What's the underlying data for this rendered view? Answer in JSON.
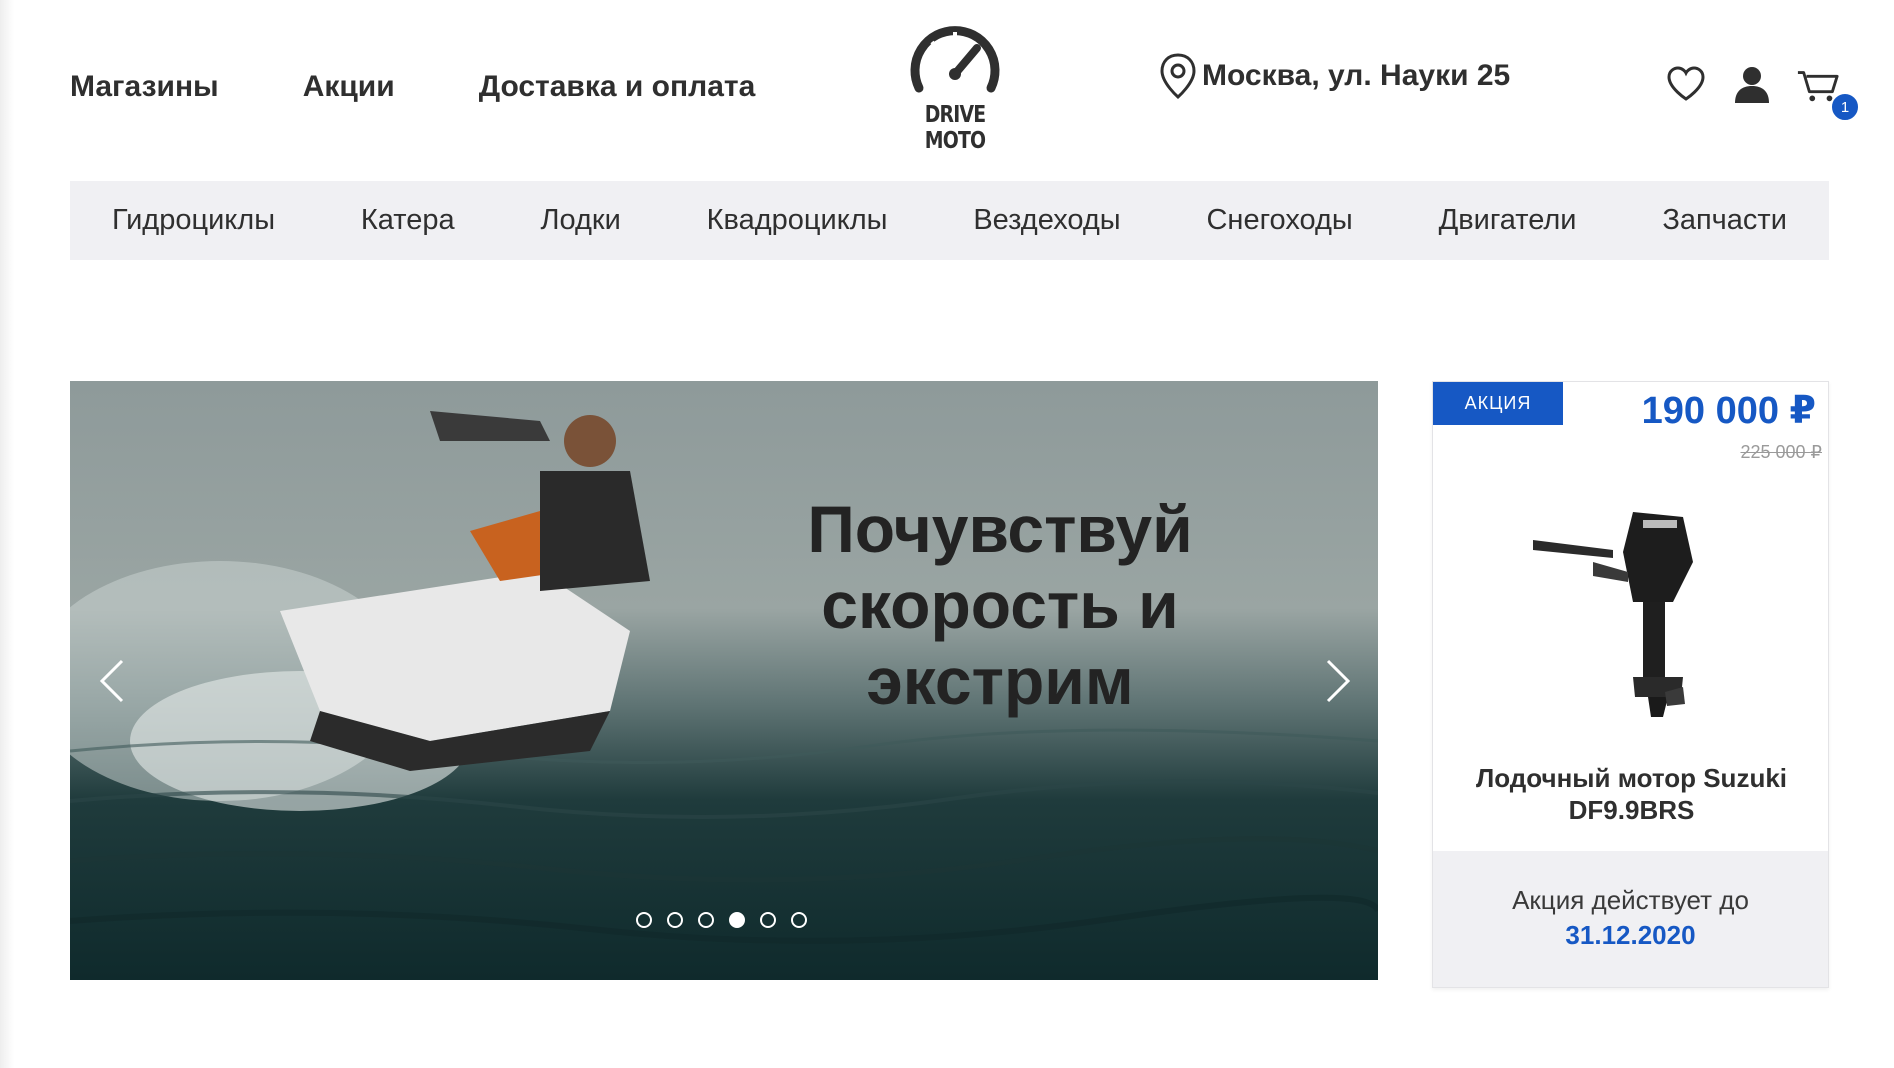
{
  "header": {
    "nav": [
      "Магазины",
      "Акции",
      "Доставка и оплата"
    ],
    "logo_text": "DRIVE MOTO",
    "address": "Москва, ул. Науки 25",
    "cart_count": "1"
  },
  "categories": [
    "Гидроциклы",
    "Катера",
    "Лодки",
    "Квадроциклы",
    "Вездеходы",
    "Снегоходы",
    "Двигатели",
    "Запчасти"
  ],
  "hero": {
    "title_lines": [
      "Почувствуй",
      "скорость и",
      "экстрим"
    ],
    "slide_count": 6,
    "active_slide": 4
  },
  "promo": {
    "badge": "АКЦИЯ",
    "price": "190 000 ₽",
    "old_price": "225 000 ₽",
    "name": "Лодочный мотор Suzuki DF9.9BRS",
    "footer_label": "Акция действует до",
    "footer_date": "31.12.2020"
  },
  "colors": {
    "accent": "#1658c4",
    "text": "#2f2f2f",
    "bar_bg": "#f0f0f3"
  }
}
